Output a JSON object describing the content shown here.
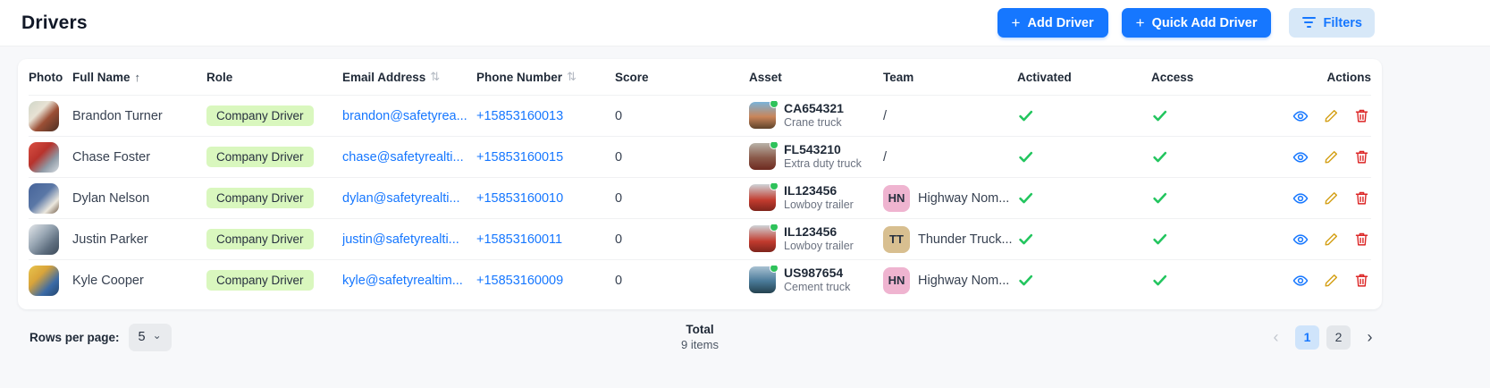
{
  "header": {
    "title": "Drivers",
    "plus_icon": "+",
    "add_driver_label": "Add Driver",
    "quick_add_label": "Quick Add Driver",
    "filters_label": "Filters"
  },
  "table": {
    "columns": [
      "Photo",
      "Full Name",
      "Role",
      "Email Address",
      "Phone Number",
      "Score",
      "Asset",
      "Team",
      "Activated",
      "Access",
      "Actions"
    ],
    "sort_asc_icon": "↑",
    "sort_both_icon": "⇅",
    "rows": [
      {
        "name": "Brandon Turner",
        "role": "Company Driver",
        "email": "brandon@safetyrea...",
        "phone": "+15853160013",
        "score": "0",
        "asset_code": "CA654321",
        "asset_type": "Crane truck",
        "asset_status": "online",
        "team_name": "/",
        "activated": true,
        "access": true
      },
      {
        "name": "Chase Foster",
        "role": "Company Driver",
        "email": "chase@safetyrealti...",
        "phone": "+15853160015",
        "score": "0",
        "asset_code": "FL543210",
        "asset_type": "Extra duty truck",
        "asset_status": "online",
        "team_name": "/",
        "activated": true,
        "access": true
      },
      {
        "name": "Dylan Nelson",
        "role": "Company Driver",
        "email": "dylan@safetyrealti...",
        "phone": "+15853160010",
        "score": "0",
        "asset_code": "IL123456",
        "asset_type": "Lowboy trailer",
        "asset_status": "online",
        "team_initials": "HN",
        "team_name": "Highway Nom...",
        "activated": true,
        "access": true
      },
      {
        "name": "Justin Parker",
        "role": "Company Driver",
        "email": "justin@safetyrealti...",
        "phone": "+15853160011",
        "score": "0",
        "asset_code": "IL123456",
        "asset_type": "Lowboy trailer",
        "asset_status": "online",
        "team_initials": "TT",
        "team_name": "Thunder Truck...",
        "activated": true,
        "access": true
      },
      {
        "name": "Kyle Cooper",
        "role": "Company Driver",
        "email": "kyle@safetyrealtim...",
        "phone": "+15853160009",
        "score": "0",
        "asset_code": "US987654",
        "asset_type": "Cement truck",
        "asset_status": "online",
        "team_initials": "HN",
        "team_name": "Highway Nom...",
        "activated": true,
        "access": true
      }
    ]
  },
  "footer": {
    "rows_per_page_label": "Rows per page:",
    "rows_per_page_value": "5",
    "caret_icon": "⌄",
    "total_label": "Total",
    "total_items": "9 items",
    "prev_icon": "‹",
    "next_icon": "›",
    "pages": [
      "1",
      "2"
    ],
    "active_page": "1"
  },
  "colors": {
    "accent_blue": "#1677ff",
    "filters_bg": "#d7e8f8",
    "chip_green_bg": "#d9f7be",
    "check_green": "#22c55e",
    "status_dot_green": "#2fc25b",
    "team_pink": "#efb4d0",
    "team_tan": "#d8bf90",
    "edit_yellow": "#d4a017",
    "delete_red": "#dc2626",
    "active_page_bg": "#cfe4fb"
  }
}
